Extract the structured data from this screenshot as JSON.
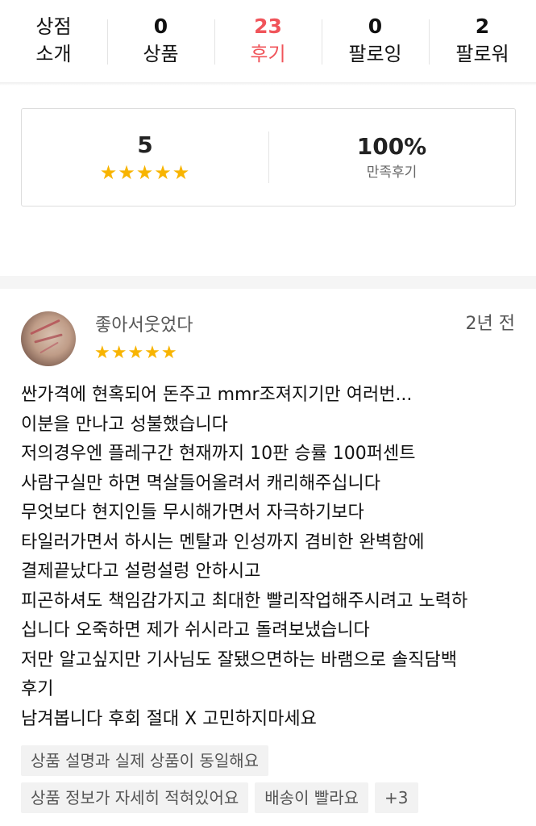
{
  "stats": [
    {
      "num": "상점",
      "label": "소개"
    },
    {
      "num": "0",
      "label": "상품"
    },
    {
      "num": "23",
      "label": "후기"
    },
    {
      "num": "0",
      "label": "팔로잉"
    },
    {
      "num": "2",
      "label": "팔로워"
    }
  ],
  "active_tab_color": "#f0545a",
  "rating_summary": {
    "score": "5",
    "stars": "★★★★★",
    "stars_value": 5,
    "satisfaction": "100%",
    "satisfaction_label": "만족후기"
  },
  "review": {
    "reviewer": "좋아서웃었다",
    "stars": "★★★★★",
    "stars_value": 5,
    "time": "2년 전",
    "lines": [
      "싼가격에 현혹되어 돈주고 mmr조져지기만 여러번...",
      "이분을 만나고 성불했습니다",
      "저의경우엔 플레구간 현재까지 10판 승률 100퍼센트",
      "사람구실만 하면 멱살들어올려서 캐리해주십니다",
      "무엇보다 현지인들 무시해가면서 자극하기보다",
      "타일러가면서 하시는 멘탈과 인성까지 겸비한 완벽함에",
      "결제끝났다고 설렁설렁 안하시고",
      "피곤하셔도 책임감가지고 최대한 빨리작업해주시려고 노력하",
      "십니다 오죽하면 제가 쉬시라고 돌려보냈습니다",
      "저만 알고싶지만 기사님도 잘됐으면하는 바램으로 솔직담백",
      "후기",
      "남겨봅니다 후회 절대 X 고민하지마세요"
    ],
    "tags_row1": [
      "상품 설명과 실제 상품이 동일해요"
    ],
    "tags_row2": [
      "상품 정보가 자세히 적혀있어요",
      "배송이 빨라요",
      "+3"
    ]
  },
  "star_color": "#f8b400"
}
